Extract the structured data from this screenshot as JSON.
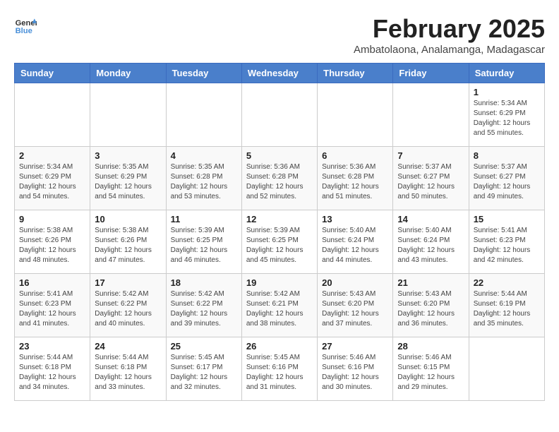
{
  "header": {
    "logo_line1": "General",
    "logo_line2": "Blue",
    "month": "February 2025",
    "location": "Ambatolaona, Analamanga, Madagascar"
  },
  "weekdays": [
    "Sunday",
    "Monday",
    "Tuesday",
    "Wednesday",
    "Thursday",
    "Friday",
    "Saturday"
  ],
  "weeks": [
    [
      {
        "day": "",
        "info": ""
      },
      {
        "day": "",
        "info": ""
      },
      {
        "day": "",
        "info": ""
      },
      {
        "day": "",
        "info": ""
      },
      {
        "day": "",
        "info": ""
      },
      {
        "day": "",
        "info": ""
      },
      {
        "day": "1",
        "info": "Sunrise: 5:34 AM\nSunset: 6:29 PM\nDaylight: 12 hours\nand 55 minutes."
      }
    ],
    [
      {
        "day": "2",
        "info": "Sunrise: 5:34 AM\nSunset: 6:29 PM\nDaylight: 12 hours\nand 54 minutes."
      },
      {
        "day": "3",
        "info": "Sunrise: 5:35 AM\nSunset: 6:29 PM\nDaylight: 12 hours\nand 54 minutes."
      },
      {
        "day": "4",
        "info": "Sunrise: 5:35 AM\nSunset: 6:28 PM\nDaylight: 12 hours\nand 53 minutes."
      },
      {
        "day": "5",
        "info": "Sunrise: 5:36 AM\nSunset: 6:28 PM\nDaylight: 12 hours\nand 52 minutes."
      },
      {
        "day": "6",
        "info": "Sunrise: 5:36 AM\nSunset: 6:28 PM\nDaylight: 12 hours\nand 51 minutes."
      },
      {
        "day": "7",
        "info": "Sunrise: 5:37 AM\nSunset: 6:27 PM\nDaylight: 12 hours\nand 50 minutes."
      },
      {
        "day": "8",
        "info": "Sunrise: 5:37 AM\nSunset: 6:27 PM\nDaylight: 12 hours\nand 49 minutes."
      }
    ],
    [
      {
        "day": "9",
        "info": "Sunrise: 5:38 AM\nSunset: 6:26 PM\nDaylight: 12 hours\nand 48 minutes."
      },
      {
        "day": "10",
        "info": "Sunrise: 5:38 AM\nSunset: 6:26 PM\nDaylight: 12 hours\nand 47 minutes."
      },
      {
        "day": "11",
        "info": "Sunrise: 5:39 AM\nSunset: 6:25 PM\nDaylight: 12 hours\nand 46 minutes."
      },
      {
        "day": "12",
        "info": "Sunrise: 5:39 AM\nSunset: 6:25 PM\nDaylight: 12 hours\nand 45 minutes."
      },
      {
        "day": "13",
        "info": "Sunrise: 5:40 AM\nSunset: 6:24 PM\nDaylight: 12 hours\nand 44 minutes."
      },
      {
        "day": "14",
        "info": "Sunrise: 5:40 AM\nSunset: 6:24 PM\nDaylight: 12 hours\nand 43 minutes."
      },
      {
        "day": "15",
        "info": "Sunrise: 5:41 AM\nSunset: 6:23 PM\nDaylight: 12 hours\nand 42 minutes."
      }
    ],
    [
      {
        "day": "16",
        "info": "Sunrise: 5:41 AM\nSunset: 6:23 PM\nDaylight: 12 hours\nand 41 minutes."
      },
      {
        "day": "17",
        "info": "Sunrise: 5:42 AM\nSunset: 6:22 PM\nDaylight: 12 hours\nand 40 minutes."
      },
      {
        "day": "18",
        "info": "Sunrise: 5:42 AM\nSunset: 6:22 PM\nDaylight: 12 hours\nand 39 minutes."
      },
      {
        "day": "19",
        "info": "Sunrise: 5:42 AM\nSunset: 6:21 PM\nDaylight: 12 hours\nand 38 minutes."
      },
      {
        "day": "20",
        "info": "Sunrise: 5:43 AM\nSunset: 6:20 PM\nDaylight: 12 hours\nand 37 minutes."
      },
      {
        "day": "21",
        "info": "Sunrise: 5:43 AM\nSunset: 6:20 PM\nDaylight: 12 hours\nand 36 minutes."
      },
      {
        "day": "22",
        "info": "Sunrise: 5:44 AM\nSunset: 6:19 PM\nDaylight: 12 hours\nand 35 minutes."
      }
    ],
    [
      {
        "day": "23",
        "info": "Sunrise: 5:44 AM\nSunset: 6:18 PM\nDaylight: 12 hours\nand 34 minutes."
      },
      {
        "day": "24",
        "info": "Sunrise: 5:44 AM\nSunset: 6:18 PM\nDaylight: 12 hours\nand 33 minutes."
      },
      {
        "day": "25",
        "info": "Sunrise: 5:45 AM\nSunset: 6:17 PM\nDaylight: 12 hours\nand 32 minutes."
      },
      {
        "day": "26",
        "info": "Sunrise: 5:45 AM\nSunset: 6:16 PM\nDaylight: 12 hours\nand 31 minutes."
      },
      {
        "day": "27",
        "info": "Sunrise: 5:46 AM\nSunset: 6:16 PM\nDaylight: 12 hours\nand 30 minutes."
      },
      {
        "day": "28",
        "info": "Sunrise: 5:46 AM\nSunset: 6:15 PM\nDaylight: 12 hours\nand 29 minutes."
      },
      {
        "day": "",
        "info": ""
      }
    ]
  ]
}
